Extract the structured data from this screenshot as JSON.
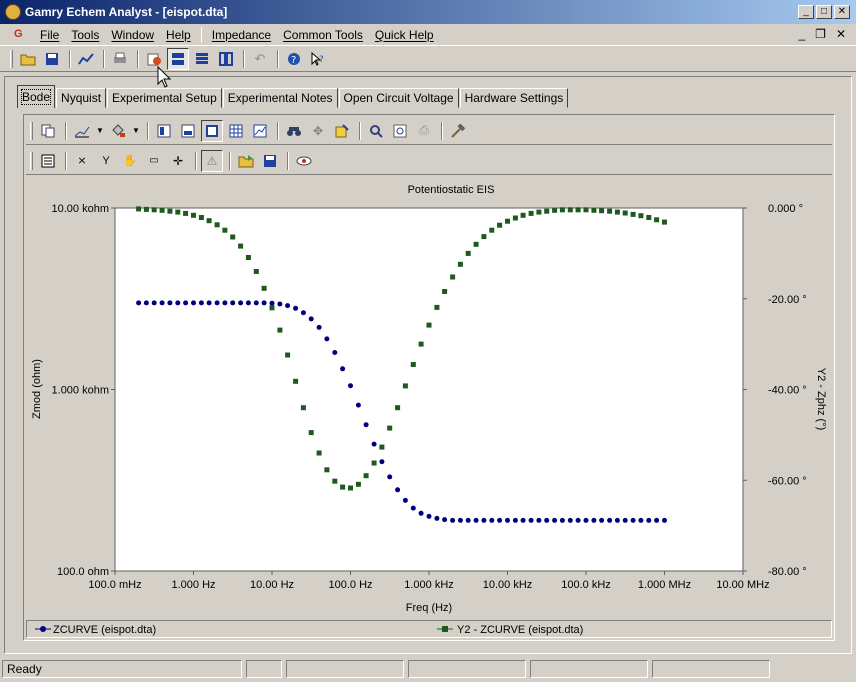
{
  "window": {
    "title": "Gamry Echem Analyst - [eispot.dta]",
    "btn_min": "_",
    "btn_max": "□",
    "btn_close": "✕"
  },
  "menu": {
    "items": [
      "File",
      "Tools",
      "Window",
      "Help",
      "Impedance",
      "Common Tools",
      "Quick Help"
    ],
    "mdi_min": "_",
    "mdi_restore": "❐",
    "mdi_close": "✕"
  },
  "tabs": [
    "Bode",
    "Nyquist",
    "Experimental Setup",
    "Experimental Notes",
    "Open Circuit Voltage",
    "Hardware Settings"
  ],
  "statusbar": {
    "text": "Ready"
  },
  "chart_data": {
    "type": "scatter",
    "title": "Potentiostatic EIS",
    "xlabel": "Freq (Hz)",
    "ylabel": "Zmod (ohm)",
    "y2label": "Y2 - Zphz (°)",
    "x_scale": "log",
    "y_scale": "log",
    "xlim": [
      0.1,
      10000000
    ],
    "ylim": [
      100,
      10000
    ],
    "y2lim": [
      -80,
      0
    ],
    "x_ticks": [
      "100.0 mHz",
      "1.000 Hz",
      "10.00 Hz",
      "100.0 Hz",
      "1.000 kHz",
      "10.00 kHz",
      "100.0 kHz",
      "1.000 MHz",
      "10.00 MHz"
    ],
    "y_ticks": [
      "10.00 kohm",
      "1.000 kohm",
      "100.0 ohm"
    ],
    "y2_ticks": [
      "0.000 °",
      "-20.00 °",
      "-40.00 °",
      "-60.00 °",
      "-80.00 °"
    ],
    "legend_placement": "bottom",
    "grid": false,
    "series": [
      {
        "name": "ZCURVE (eispot.dta)",
        "axis": "left",
        "marker": "circle",
        "color": "#000080",
        "x": [
          0.2,
          0.251,
          0.316,
          0.398,
          0.501,
          0.631,
          0.794,
          1,
          1.26,
          1.58,
          2,
          2.51,
          3.16,
          3.98,
          5.01,
          6.31,
          7.94,
          10,
          12.6,
          15.8,
          20,
          25.1,
          31.6,
          39.8,
          50.1,
          63.1,
          79.4,
          100,
          126,
          158,
          200,
          251,
          316,
          398,
          501,
          631,
          794,
          1000,
          1260,
          1580,
          2000,
          2510,
          3160,
          3980,
          5010,
          6310,
          7940,
          10000,
          12600,
          15800,
          20000,
          25100,
          31600,
          39800,
          50100,
          63100,
          79400,
          100000,
          126000,
          158000,
          200000,
          251000,
          316000,
          398000,
          501000,
          631000,
          794000,
          1000000
        ],
        "y": [
          3000,
          3000,
          3000,
          3000,
          3000,
          3000,
          3000,
          3000,
          3000,
          3000,
          3000,
          3000,
          3000,
          3000,
          3000,
          3000,
          3000,
          2990,
          2960,
          2900,
          2800,
          2650,
          2450,
          2200,
          1900,
          1600,
          1300,
          1050,
          820,
          640,
          500,
          400,
          330,
          280,
          245,
          222,
          208,
          200,
          195,
          192,
          190,
          190,
          190,
          190,
          190,
          190,
          190,
          190,
          190,
          190,
          190,
          190,
          190,
          190,
          190,
          190,
          190,
          190,
          190,
          190,
          190,
          190,
          190,
          190,
          190,
          190,
          190,
          190
        ]
      },
      {
        "name": "Y2 - ZCURVE (eispot.dta)",
        "axis": "right",
        "marker": "square",
        "color": "#1e5a1e",
        "x": [
          0.2,
          0.251,
          0.316,
          0.398,
          0.501,
          0.631,
          0.794,
          1,
          1.26,
          1.58,
          2,
          2.51,
          3.16,
          3.98,
          5.01,
          6.31,
          7.94,
          10,
          12.6,
          15.8,
          20,
          25.1,
          31.6,
          39.8,
          50.1,
          63.1,
          79.4,
          100,
          126,
          158,
          200,
          251,
          316,
          398,
          501,
          631,
          794,
          1000,
          1260,
          1580,
          2000,
          2510,
          3160,
          3980,
          5010,
          6310,
          7940,
          10000,
          12600,
          15800,
          20000,
          25100,
          31600,
          39800,
          50100,
          63100,
          79400,
          100000,
          126000,
          158000,
          200000,
          251000,
          316000,
          398000,
          501000,
          631000,
          794000,
          1000000
        ],
        "y": [
          -0.2,
          -0.3,
          -0.4,
          -0.5,
          -0.7,
          -0.9,
          -1.2,
          -1.6,
          -2.1,
          -2.8,
          -3.7,
          -4.9,
          -6.4,
          -8.4,
          -10.9,
          -14,
          -17.7,
          -22,
          -26.9,
          -32.4,
          -38.2,
          -44,
          -49.5,
          -54,
          -57.7,
          -60.2,
          -61.5,
          -61.7,
          -60.9,
          -59,
          -56.2,
          -52.7,
          -48.5,
          -44,
          -39.2,
          -34.5,
          -30,
          -25.8,
          -21.9,
          -18.4,
          -15.2,
          -12.4,
          -10,
          -8,
          -6.3,
          -4.9,
          -3.8,
          -2.9,
          -2.2,
          -1.6,
          -1.2,
          -0.9,
          -0.7,
          -0.5,
          -0.4,
          -0.4,
          -0.4,
          -0.4,
          -0.5,
          -0.6,
          -0.7,
          -0.9,
          -1.1,
          -1.4,
          -1.7,
          -2.1,
          -2.6,
          -3.1
        ]
      }
    ]
  }
}
